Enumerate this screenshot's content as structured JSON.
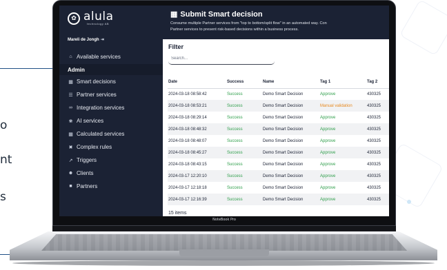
{
  "page": {
    "fragments": [
      "o",
      "nt",
      "s"
    ]
  },
  "device": {
    "brand": "NoteBook Pro"
  },
  "sidebar": {
    "logo": {
      "name": "alula",
      "sub": "technology AB"
    },
    "user": "Mareli de Jongh",
    "top_item": {
      "label": "Available services",
      "icon": "home-icon"
    },
    "section": "Admin",
    "items": [
      {
        "label": "Smart decisions",
        "icon": "sitemap-icon"
      },
      {
        "label": "Partner services",
        "icon": "list-icon"
      },
      {
        "label": "Integration services",
        "icon": "link-icon"
      },
      {
        "label": "AI services",
        "icon": "brain-icon"
      },
      {
        "label": "Calculated services",
        "icon": "calculator-icon"
      },
      {
        "label": "Complex rules",
        "icon": "tools-icon"
      },
      {
        "label": "Triggers",
        "icon": "trigger-icon"
      },
      {
        "label": "Clients",
        "icon": "users-icon"
      },
      {
        "label": "Partners",
        "icon": "partners-icon"
      }
    ]
  },
  "header": {
    "title": "Submit Smart decision",
    "description_line1": "Consume multiple Partner services from \"top to bottom/split flow\" in an automated way. Con",
    "description_line2": "Partner services to present risk-based decisions within a business process."
  },
  "filter": {
    "label": "Filter",
    "placeholder": "Search..."
  },
  "table": {
    "columns": [
      "Date",
      "Success",
      "Name",
      "Tag 1",
      "Tag 2"
    ],
    "rows": [
      {
        "date": "2024-03-18 08:58:42",
        "success": "Success",
        "name": "Demo Smart Decision",
        "tag1": "Approve",
        "tag1_status": "ok",
        "tag2": "430325"
      },
      {
        "date": "2024-03-18 08:53:21",
        "success": "Success",
        "name": "Demo Smart Decision",
        "tag1": "Manual validation",
        "tag1_status": "warn",
        "tag2": "430325"
      },
      {
        "date": "2024-03-18 08:29:14",
        "success": "Success",
        "name": "Demo Smart Decision",
        "tag1": "Approve",
        "tag1_status": "ok",
        "tag2": "430325"
      },
      {
        "date": "2024-03-18 08:48:32",
        "success": "Success",
        "name": "Demo Smart Decision",
        "tag1": "Approve",
        "tag1_status": "ok",
        "tag2": "430325"
      },
      {
        "date": "2024-03-18 08:48:07",
        "success": "Success",
        "name": "Demo Smart Decision",
        "tag1": "Approve",
        "tag1_status": "ok",
        "tag2": "430325"
      },
      {
        "date": "2024-03-18 08:45:27",
        "success": "Success",
        "name": "Demo Smart Decision",
        "tag1": "Approve",
        "tag1_status": "ok",
        "tag2": "430325"
      },
      {
        "date": "2024-03-18 08:43:15",
        "success": "Success",
        "name": "Demo Smart Decision",
        "tag1": "Approve",
        "tag1_status": "ok",
        "tag2": "430325"
      },
      {
        "date": "2024-03-17 12:20:10",
        "success": "Success",
        "name": "Demo Smart Decision",
        "tag1": "Approve",
        "tag1_status": "ok",
        "tag2": "430325"
      },
      {
        "date": "2024-03-17 12:18:18",
        "success": "Success",
        "name": "Demo Smart Decision",
        "tag1": "Approve",
        "tag1_status": "ok",
        "tag2": "430325"
      },
      {
        "date": "2024-03-17 12:16:39",
        "success": "Success",
        "name": "Demo Smart Decision",
        "tag1": "Approve",
        "tag1_status": "ok",
        "tag2": "430325"
      }
    ],
    "footer": "15 items"
  },
  "colors": {
    "sidebar_bg": "#1b2234",
    "success": "#2e9e4a",
    "warning": "#e6881e"
  }
}
